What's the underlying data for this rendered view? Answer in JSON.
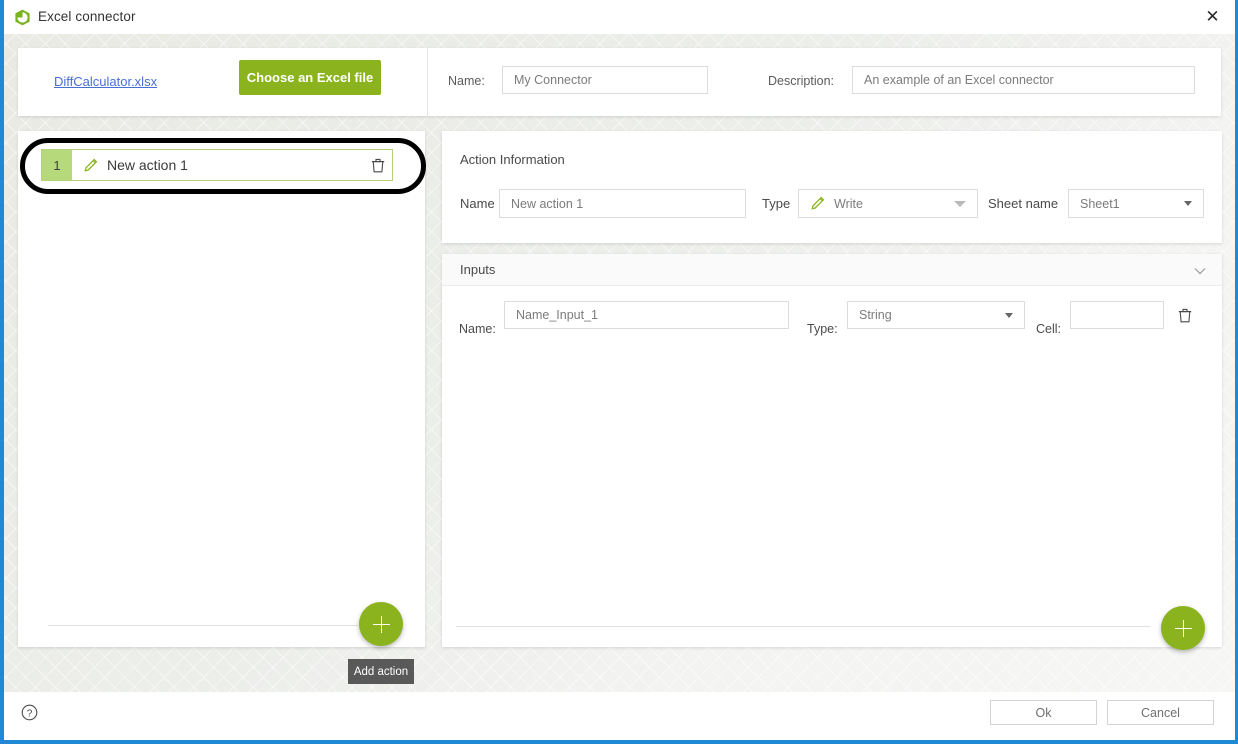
{
  "window": {
    "title": "Excel connector",
    "title_icon": "excel-connector-icon",
    "close_icon": "close-icon",
    "accent_color": "#1e8ad6",
    "brand_green": "#8bb31d"
  },
  "header": {
    "file_link": "DiffCalculator.xlsx",
    "choose_file_label": "Choose an Excel file",
    "name_label": "Name:",
    "name_value": "My Connector",
    "description_label": "Description:",
    "description_value": "An example of an Excel connector"
  },
  "actions_panel": {
    "items": [
      {
        "index": "1",
        "name": "New action 1",
        "edit_icon": "pencil-icon",
        "delete_icon": "trash-icon"
      }
    ],
    "add_fab_icon": "plus-icon",
    "add_tooltip": "Add action"
  },
  "action_information": {
    "title": "Action Information",
    "name_label": "Name",
    "name_value": "New action 1",
    "type_label": "Type",
    "type_value": "Write",
    "type_icon": "pencil-icon",
    "sheet_label": "Sheet name",
    "sheet_value": "Sheet1"
  },
  "inputs": {
    "title": "Inputs",
    "collapse_icon": "chevron-down-icon",
    "rows": [
      {
        "name_label": "Name:",
        "name_value": "Name_Input_1",
        "type_label": "Type:",
        "type_value": "String",
        "cell_label": "Cell:",
        "cell_value": "",
        "cell_placeholder": "",
        "delete_icon": "trash-icon"
      }
    ],
    "add_fab_icon": "plus-icon"
  },
  "footer": {
    "help_icon": "help-icon",
    "ok_label": "Ok",
    "cancel_label": "Cancel"
  }
}
